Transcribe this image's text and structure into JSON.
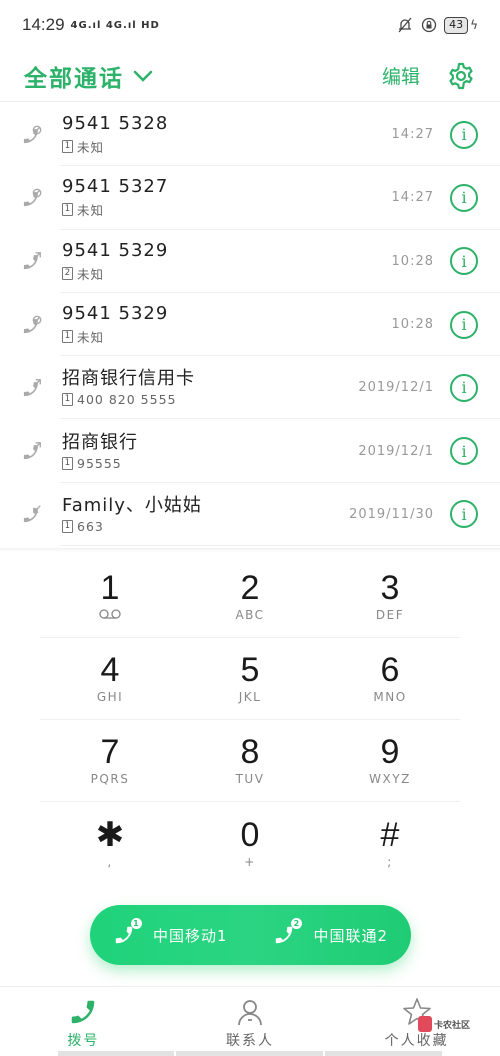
{
  "status_bar": {
    "time": "14:29",
    "signals": "4G.ıl 4G.ıl HD",
    "battery": "43"
  },
  "header": {
    "title": "全部通话",
    "edit_label": "编辑"
  },
  "calls": [
    {
      "name": "9541 5328",
      "sim": "1",
      "sub": "未知",
      "time": "14:27",
      "type": "rejected"
    },
    {
      "name": "9541 5327",
      "sim": "1",
      "sub": "未知",
      "time": "14:27",
      "type": "rejected"
    },
    {
      "name": "9541 5329",
      "sim": "2",
      "sub": "未知",
      "time": "10:28",
      "type": "outgoing"
    },
    {
      "name": "9541 5329",
      "sim": "1",
      "sub": "未知",
      "time": "10:28",
      "type": "rejected"
    },
    {
      "name": "招商银行信用卡",
      "sim": "1",
      "sub": "400 820 5555",
      "time": "2019/12/1",
      "type": "outgoing"
    },
    {
      "name": "招商银行",
      "sim": "1",
      "sub": "95555",
      "time": "2019/12/1",
      "type": "outgoing"
    },
    {
      "name": "Family、小姑姑",
      "sim": "1",
      "sub": "663",
      "time": "2019/11/30",
      "type": "incoming"
    }
  ],
  "keypad": [
    [
      {
        "digit": "1",
        "letters": "voicemail"
      },
      {
        "digit": "2",
        "letters": "ABC"
      },
      {
        "digit": "3",
        "letters": "DEF"
      }
    ],
    [
      {
        "digit": "4",
        "letters": "GHI"
      },
      {
        "digit": "5",
        "letters": "JKL"
      },
      {
        "digit": "6",
        "letters": "MNO"
      }
    ],
    [
      {
        "digit": "7",
        "letters": "PQRS"
      },
      {
        "digit": "8",
        "letters": "TUV"
      },
      {
        "digit": "9",
        "letters": "WXYZ"
      }
    ],
    [
      {
        "digit": "✱",
        "letters": ","
      },
      {
        "digit": "0",
        "letters": "+"
      },
      {
        "digit": "#",
        "letters": ";"
      }
    ]
  ],
  "call_buttons": [
    {
      "sim": "1",
      "label": "中国移动1"
    },
    {
      "sim": "2",
      "label": "中国联通2"
    }
  ],
  "bottom_nav": [
    {
      "label": "拨号",
      "icon": "phone-icon",
      "active": true
    },
    {
      "label": "联系人",
      "icon": "person-icon",
      "active": false
    },
    {
      "label": "个人收藏",
      "icon": "star-icon",
      "active": false
    }
  ],
  "watermark": "卡农社区",
  "colors": {
    "accent": "#2db26a",
    "call_button": "#22d07a"
  }
}
